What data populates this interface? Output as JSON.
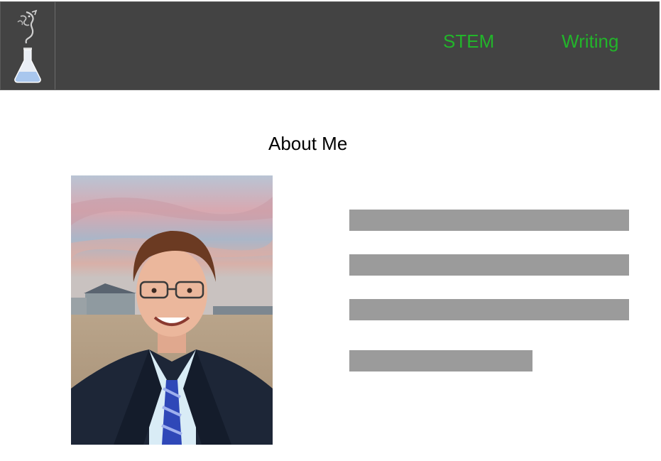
{
  "nav": {
    "logo_name": "dragon-flask-logo",
    "links": [
      {
        "label": "STEM"
      },
      {
        "label": "Writing"
      }
    ],
    "link_color": "#22b52a",
    "background": "#434343"
  },
  "main": {
    "title": "About Me",
    "portrait_icon": "person-photo",
    "placeholder_color": "#9b9b9b",
    "placeholder_lines": 4
  }
}
